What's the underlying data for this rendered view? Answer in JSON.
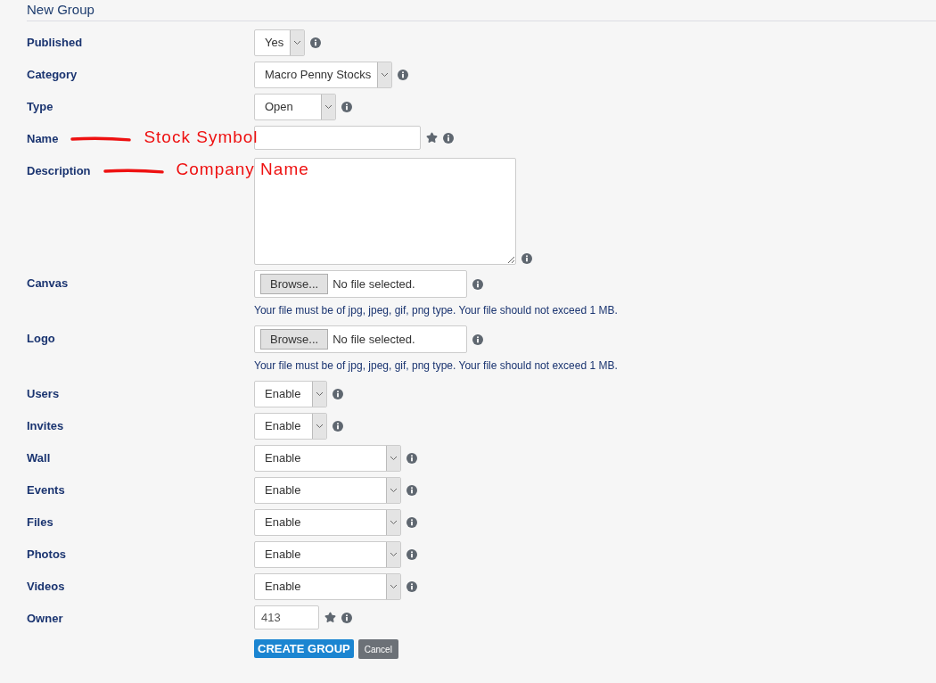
{
  "title": "New Group",
  "fields": [
    {
      "label": "Published",
      "kind": "select",
      "value": "Yes",
      "required": false
    },
    {
      "label": "Category",
      "kind": "select",
      "value": "Macro Penny Stocks",
      "required": false
    },
    {
      "label": "Type",
      "kind": "select",
      "value": "Open",
      "required": false
    },
    {
      "label": "Name",
      "kind": "text",
      "required": true,
      "annotation": "Stock Symbol"
    },
    {
      "label": "Description",
      "kind": "textarea",
      "required": false,
      "annotation": "Company Name"
    },
    {
      "label": "Canvas",
      "kind": "file",
      "button": "Browse...",
      "value": "No file selected.",
      "hint": "Your file must be of jpg, jpeg, gif, png type. Your file should not exceed 1 MB.",
      "required": false
    },
    {
      "label": "Logo",
      "kind": "file",
      "button": "Browse...",
      "value": "No file selected.",
      "hint": "Your file must be of jpg, jpeg, gif, png type. Your file should not exceed 1 MB.",
      "required": false
    },
    {
      "label": "Users",
      "kind": "select",
      "value": "Enable",
      "required": false
    },
    {
      "label": "Invites",
      "kind": "select",
      "value": "Enable",
      "required": false
    },
    {
      "label": "Wall",
      "kind": "select",
      "value": "Enable",
      "required": false
    },
    {
      "label": "Events",
      "kind": "select",
      "value": "Enable",
      "required": false
    },
    {
      "label": "Files",
      "kind": "select",
      "value": "Enable",
      "required": false
    },
    {
      "label": "Photos",
      "kind": "select",
      "value": "Enable",
      "required": false
    },
    {
      "label": "Videos",
      "kind": "select",
      "value": "Enable",
      "required": false
    },
    {
      "label": "Owner",
      "kind": "text",
      "value": "413",
      "required": true
    }
  ],
  "buttons": [
    {
      "label": "CREATE GROUP",
      "kind": "primary"
    },
    {
      "label": "Cancel",
      "kind": "secondary"
    }
  ]
}
